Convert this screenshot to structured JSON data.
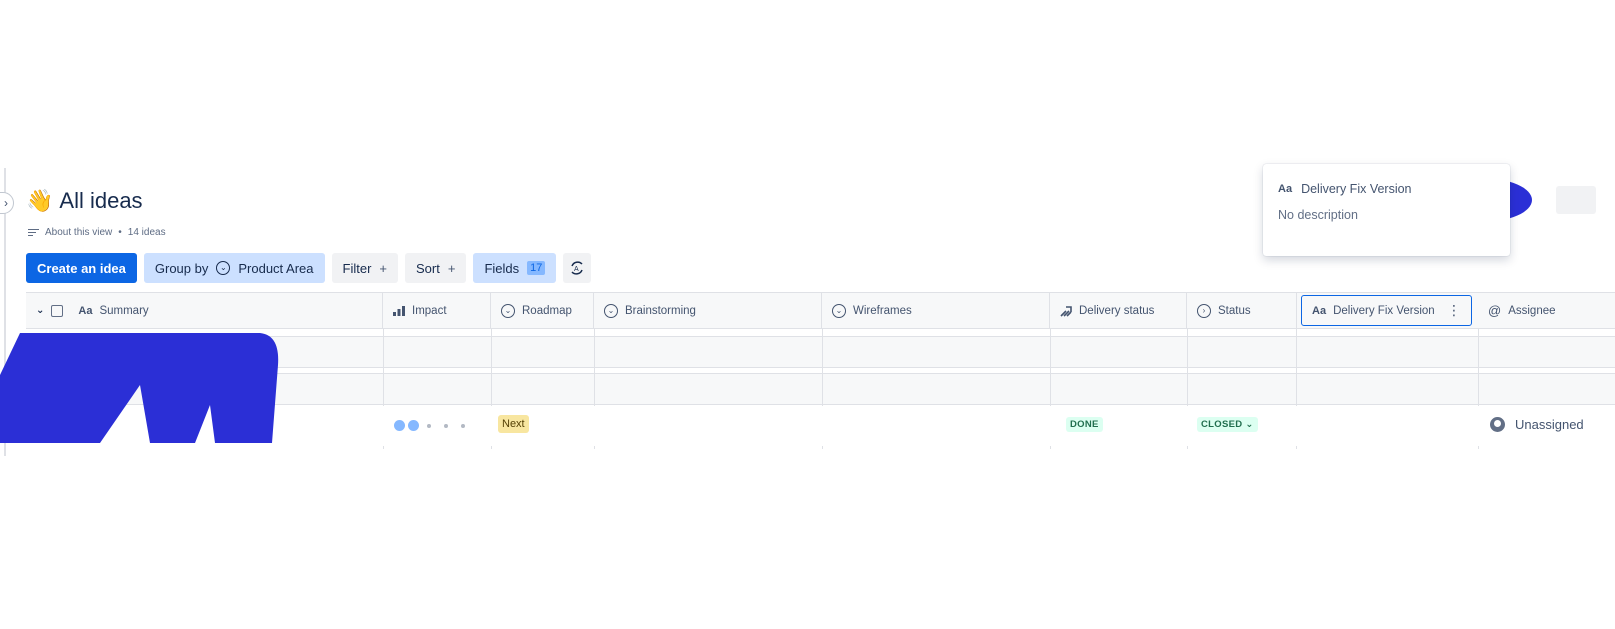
{
  "page": {
    "title": "All ideas",
    "title_emoji": "👋",
    "about_label": "About this view",
    "ideas_count": "14 ideas",
    "separator": "•"
  },
  "toolbar": {
    "create_label": "Create an idea",
    "group_by_label": "Group by",
    "group_by_value": "Product Area",
    "filter_label": "Filter",
    "sort_label": "Sort",
    "fields_label": "Fields",
    "fields_count": "17",
    "plus": "+"
  },
  "table": {
    "columns": [
      {
        "label": "Summary",
        "icon": "Aa"
      },
      {
        "label": "Impact",
        "icon": "bar-chart-icon"
      },
      {
        "label": "Roadmap",
        "icon": "chevron-circle-icon"
      },
      {
        "label": "Brainstorming",
        "icon": "chevron-circle-icon"
      },
      {
        "label": "Wireframes",
        "icon": "chevron-circle-icon"
      },
      {
        "label": "Delivery status",
        "icon": "delivery-icon"
      },
      {
        "label": "Status",
        "icon": "arrow-circle-icon"
      },
      {
        "label": "Delivery Fix Version",
        "icon": "Aa"
      },
      {
        "label": "Assignee",
        "icon": "@"
      }
    ],
    "row": {
      "impact_level": 2,
      "impact_max": 5,
      "roadmap": "Next",
      "delivery_status": "DONE",
      "status": "CLOSED",
      "assignee": "Unassigned"
    }
  },
  "popup": {
    "icon": "Aa",
    "title": "Delivery Fix Version",
    "description": "No description"
  },
  "colors": {
    "primary": "#0c66e4",
    "selected_bg": "#cce0ff",
    "scribble": "#2b2fd6",
    "next_bg": "#f8e6a0",
    "done_bg": "#dcfff1"
  }
}
